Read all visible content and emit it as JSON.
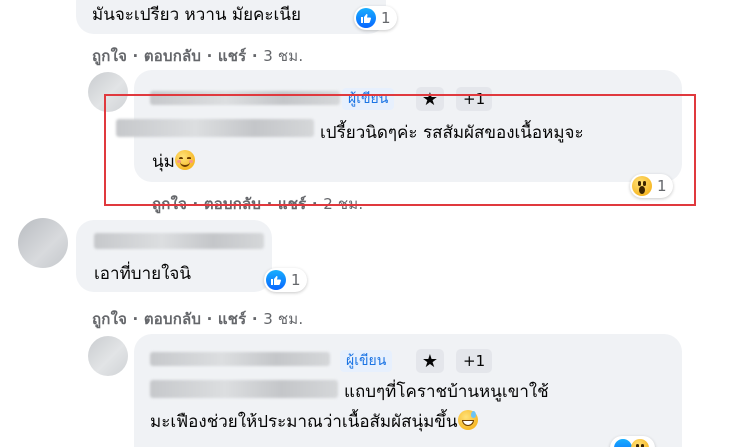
{
  "comment1": {
    "text": "มันจะเปรียว หวาน มัยคะเนีย",
    "like_count": "1",
    "actions": {
      "like": "ถูกใจ",
      "reply": "ตอบกลับ",
      "share": "แชร์",
      "sep": "·",
      "time": "3 ชม."
    }
  },
  "comment2": {
    "author_badge": "ผู้เขียน",
    "star_badge": "★",
    "plus_badge": "+1",
    "text_line1": "เปรี้ยวนิดๆค่ะ รสสัมผัสของเนื้อหมูจะ",
    "text_line2": "นุ่ม",
    "reaction": {
      "type": "wow",
      "count": "1"
    },
    "actions": {
      "like": "ถูกใจ",
      "reply": "ตอบกลับ",
      "share": "แชร์",
      "sep": "·",
      "time": "2 ชม."
    }
  },
  "comment3": {
    "text": "เอาที่บายใจนิ",
    "like_count": "1",
    "actions": {
      "like": "ถูกใจ",
      "reply": "ตอบกลับ",
      "share": "แชร์",
      "sep": "·",
      "time": "3 ชม."
    }
  },
  "comment4": {
    "author_badge": "ผู้เขียน",
    "star_badge": "★",
    "plus_badge": "+1",
    "text_line1": "แถบๆที่โคราชบ้านหนูเขาใช้",
    "text_line2": "มะเฟืองช่วยให้ประมาณว่าเนื้อสัมผัสนุ่มขึ้น"
  },
  "colors": {
    "highlight": "#e0393e",
    "link_blue": "#1b74e4",
    "bubble": "#f0f2f5",
    "meta": "#65676b"
  },
  "icons": {
    "like": "like-icon",
    "wow": "wow-reaction-icon",
    "star": "star-icon"
  }
}
